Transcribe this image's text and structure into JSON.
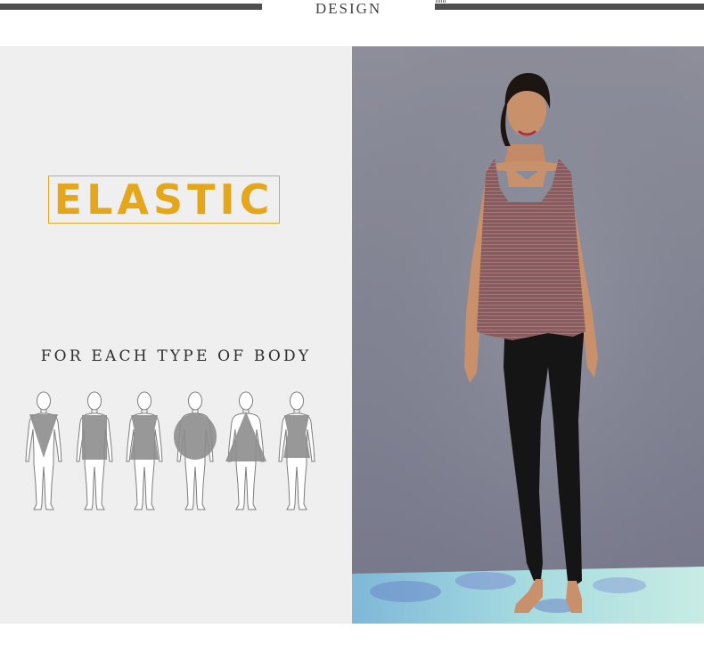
{
  "header": {
    "title": "DESIGN"
  },
  "feature": {
    "badge": "ELASTIC"
  },
  "body_types": {
    "caption": "FOR EACH TYPE OF BODY",
    "shapes": [
      "inverted-triangle",
      "rectangle",
      "hourglass",
      "round",
      "triangle",
      "hourglass"
    ]
  },
  "photo": {
    "subject": "model-in-tank-top-and-leggings",
    "colors": {
      "backdrop": "#838491",
      "top": "#8a5a5c",
      "leggings": "#151515",
      "mat": "#9ad3dc"
    }
  },
  "colors": {
    "accent": "#e4a71c",
    "panel": "#efefef",
    "rule": "#4f4f4f"
  }
}
